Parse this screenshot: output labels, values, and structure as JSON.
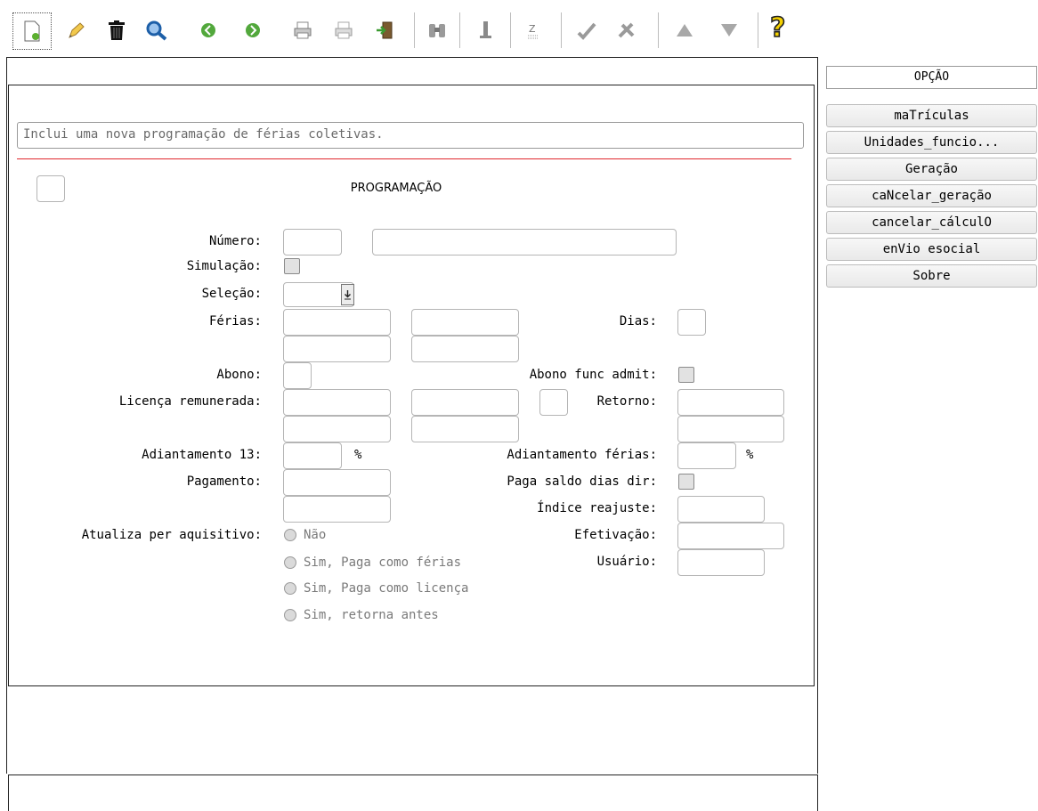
{
  "toolbar": {
    "items": [
      "new-icon",
      "edit-icon",
      "delete-icon",
      "search-icon",
      "previous-icon",
      "next-icon",
      "print-icon",
      "print-preview-icon",
      "exit-icon",
      "binoculars-icon",
      "info-icon",
      "sort-icon",
      "check-icon",
      "cancel-icon",
      "up-icon",
      "filter-icon",
      "help-icon"
    ],
    "help_glyph": "?"
  },
  "main": {
    "description": "Inclui uma nova programação de férias coletivas.",
    "section_title": "PROGRAMAÇÃO",
    "accent_color": "#e0282d"
  },
  "form": {
    "numero_label": "Número:",
    "simulacao_label": "Simulação:",
    "selecao_label": "Seleção:",
    "ferias_label": "Férias:",
    "dias_label": "Dias:",
    "abono_label": "Abono:",
    "abono_func_label": "Abono func admit:",
    "licenca_label": "Licença remunerada:",
    "retorno_label": "Retorno:",
    "adiant13_label": "Adiantamento 13:",
    "percent1": "%",
    "adiant_ferias_label": "Adiantamento férias:",
    "percent2": "%",
    "pagamento_label": "Pagamento:",
    "paga_saldo_label": "Paga saldo dias dir:",
    "indice_label": "Índice reajuste:",
    "atualiza_label": "Atualiza per aquisitivo:",
    "efetivacao_label": "Efetivação:",
    "usuario_label": "Usuário:",
    "radio_options": [
      "Não",
      "Sim, Paga como férias",
      "Sim, Paga como licença",
      "Sim, retorna antes"
    ]
  },
  "sidebar": {
    "header": "OPÇÃO",
    "buttons": [
      "maTrículas",
      "Unidades_funcio...",
      "Geração",
      "caNcelar_geração",
      "cancelar_cálculO",
      "enVio esocial",
      "Sobre"
    ]
  }
}
